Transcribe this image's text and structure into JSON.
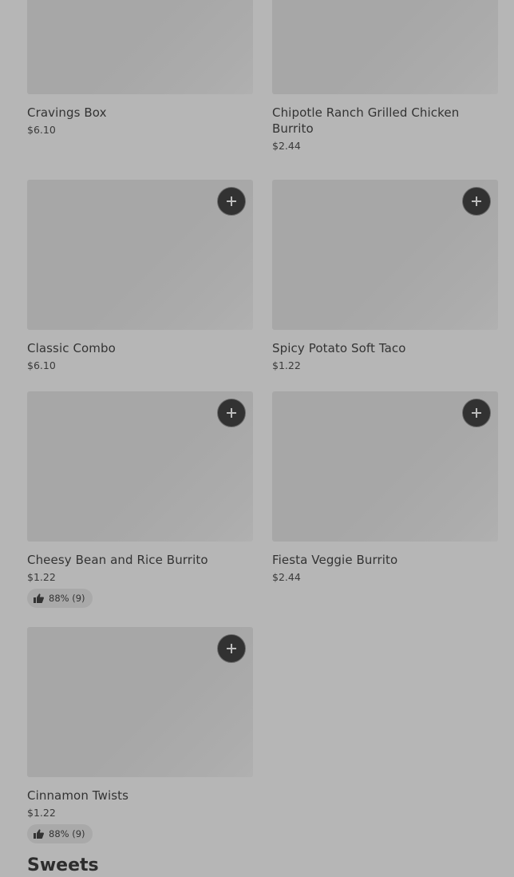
{
  "items": [
    {
      "name": "Cravings Box",
      "price": "$6.10"
    },
    {
      "name": "Chipotle Ranch Grilled Chicken Burrito",
      "price": "$2.44"
    },
    {
      "name": "Classic Combo",
      "price": "$6.10"
    },
    {
      "name": "Spicy Potato Soft Taco",
      "price": "$1.22"
    },
    {
      "name": "Cheesy Bean and Rice Burrito",
      "price": "$1.22",
      "rating": "88% (9)"
    },
    {
      "name": "Fiesta Veggie Burrito",
      "price": "$2.44"
    },
    {
      "name": "Cinnamon Twists",
      "price": "$1.22",
      "rating": "88% (9)"
    }
  ],
  "next_section": {
    "title": "Sweets"
  },
  "icons": {
    "add": "plus-icon",
    "rating": "thumbs-up-icon"
  },
  "colors": {
    "background": "#b6b6b6",
    "button": "#323232",
    "image_placeholder": "#a7a7a7"
  }
}
